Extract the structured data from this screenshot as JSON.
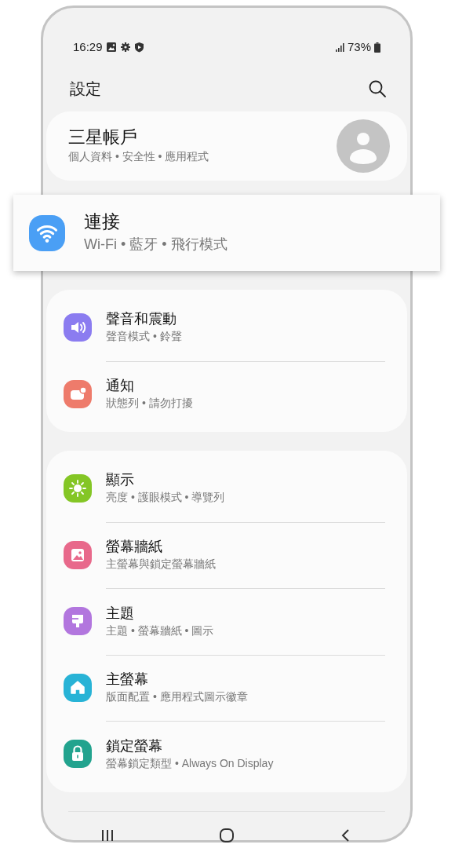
{
  "status_bar": {
    "time": "16:29",
    "battery": "73%"
  },
  "header": {
    "title": "設定"
  },
  "account": {
    "name": "三星帳戶",
    "subtitle": "個人資料 • 安全性 • 應用程式"
  },
  "highlighted_item": {
    "title": "連接",
    "subtitle": "Wi-Fi • 藍牙 • 飛行模式",
    "kind": "wifi",
    "color": "#4a9ff5"
  },
  "groups": [
    {
      "items": [
        {
          "title": "聲音和震動",
          "subtitle": "聲音模式 • 鈴聲",
          "kind": "sound",
          "color": "#8b7cf0"
        },
        {
          "title": "通知",
          "subtitle": "狀態列 • 請勿打擾",
          "kind": "notification",
          "color": "#ee7b6b"
        }
      ]
    },
    {
      "items": [
        {
          "title": "顯示",
          "subtitle": "亮度 • 護眼模式 • 導覽列",
          "kind": "display",
          "color": "#84c625"
        },
        {
          "title": "螢幕牆紙",
          "subtitle": "主螢幕與鎖定螢幕牆紙",
          "kind": "wallpaper",
          "color": "#e8698b"
        },
        {
          "title": "主題",
          "subtitle": "主題 • 螢幕牆紙 • 圖示",
          "kind": "theme",
          "color": "#b276de"
        },
        {
          "title": "主螢幕",
          "subtitle": "版面配置 • 應用程式圖示徽章",
          "kind": "home",
          "color": "#28b3d6"
        },
        {
          "title": "鎖定螢幕",
          "subtitle": "螢幕鎖定類型 • Always On Display",
          "kind": "lock",
          "color": "#22a38e"
        }
      ]
    }
  ]
}
